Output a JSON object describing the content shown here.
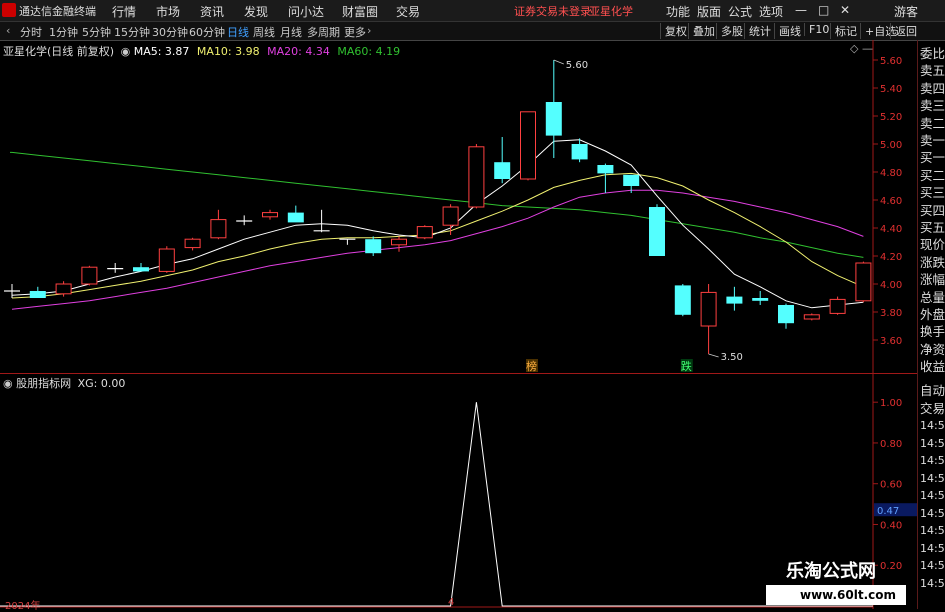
{
  "menu": {
    "app_title": "通达信金融终端",
    "items": [
      "行情",
      "市场",
      "资讯",
      "发现",
      "问小达",
      "财富圈",
      "交易"
    ],
    "status_text": "证券交易未登录",
    "stock_name": "亚星化学",
    "right_items": [
      "功能",
      "版面",
      "公式",
      "选项"
    ],
    "user": "游客"
  },
  "toolbar": {
    "periods": [
      "分时",
      "1分钟",
      "5分钟",
      "15分钟",
      "30分钟",
      "60分钟",
      "日线",
      "周线",
      "月线",
      "多周期",
      "更多"
    ],
    "active_period": "日线",
    "right_buttons": [
      "复权",
      "叠加",
      "多股",
      "统计",
      "画线",
      "F10",
      "标记",
      "+自选",
      "返回"
    ]
  },
  "main_legend": {
    "title": "亚星化学(日线 前复权)",
    "ma5": "MA5: 3.87",
    "ma10": "MA10: 3.98",
    "ma20": "MA20: 4.34",
    "ma60": "MA60: 4.19"
  },
  "indicator_legend": {
    "title": "股朋指标网",
    "xg": "XG: 0.00"
  },
  "annotations": {
    "high_label": "5.60",
    "low_label": "3.50",
    "bang_marker": "榜",
    "die_marker": "跌"
  },
  "axis": {
    "price_ticks": [
      "5.60",
      "5.40",
      "5.20",
      "5.00",
      "4.80",
      "4.60",
      "4.40",
      "4.20",
      "4.00",
      "3.80",
      "3.60"
    ],
    "indicator_ticks": [
      "1.00",
      "0.80",
      "0.60",
      "0.40",
      "0.20"
    ],
    "indicator_current": "0.47",
    "x_labels": [
      "2024年",
      "4"
    ]
  },
  "side_panel": {
    "top_items": [
      "委比",
      "卖五",
      "卖四",
      "卖三",
      "卖二",
      "卖一",
      "买一",
      "买二",
      "买三",
      "买四",
      "买五",
      "现价",
      "涨跌",
      "涨幅",
      "总量",
      "外盘",
      "换手",
      "净资",
      "收益"
    ],
    "bottom_items": [
      "自动",
      "交易",
      "14:55",
      "14:55",
      "14:55",
      "14:55",
      "14:56",
      "14:56",
      "14:56",
      "14:56",
      "14:56",
      "14:56"
    ]
  },
  "watermark": {
    "title": "乐淘公式网",
    "url": "www.60lt.com"
  },
  "colors": {
    "up": "#ff4040",
    "down": "#54ffff",
    "ma5": "#ffffff",
    "ma10": "#f0f070",
    "ma20": "#e040e0",
    "ma60": "#30c030",
    "axis": "#a01818",
    "indicator_line": "#ffffff"
  },
  "chart_data": [
    {
      "type": "candlestick",
      "ylim": [
        3.5,
        5.6
      ],
      "candles": [
        {
          "o": 3.95,
          "h": 4.0,
          "l": 3.9,
          "c": 3.95
        },
        {
          "o": 3.95,
          "h": 3.98,
          "l": 3.92,
          "c": 3.9
        },
        {
          "o": 3.93,
          "h": 4.02,
          "l": 3.91,
          "c": 4.0
        },
        {
          "o": 4.0,
          "h": 4.13,
          "l": 3.99,
          "c": 4.12
        },
        {
          "o": 4.11,
          "h": 4.15,
          "l": 4.08,
          "c": 4.11
        },
        {
          "o": 4.12,
          "h": 4.15,
          "l": 4.09,
          "c": 4.09
        },
        {
          "o": 4.09,
          "h": 4.27,
          "l": 4.08,
          "c": 4.25
        },
        {
          "o": 4.26,
          "h": 4.33,
          "l": 4.24,
          "c": 4.32
        },
        {
          "o": 4.33,
          "h": 4.53,
          "l": 4.32,
          "c": 4.46
        },
        {
          "o": 4.44,
          "h": 4.49,
          "l": 4.42,
          "c": 4.45
        },
        {
          "o": 4.48,
          "h": 4.53,
          "l": 4.46,
          "c": 4.51
        },
        {
          "o": 4.51,
          "h": 4.56,
          "l": 4.45,
          "c": 4.44
        },
        {
          "o": 4.38,
          "h": 4.53,
          "l": 4.37,
          "c": 4.38
        },
        {
          "o": 4.31,
          "h": 4.32,
          "l": 4.28,
          "c": 4.32
        },
        {
          "o": 4.32,
          "h": 4.34,
          "l": 4.2,
          "c": 4.22
        },
        {
          "o": 4.28,
          "h": 4.34,
          "l": 4.23,
          "c": 4.32
        },
        {
          "o": 4.33,
          "h": 4.42,
          "l": 4.32,
          "c": 4.41
        },
        {
          "o": 4.42,
          "h": 4.57,
          "l": 4.35,
          "c": 4.55
        },
        {
          "o": 4.55,
          "h": 5.0,
          "l": 4.54,
          "c": 4.98
        },
        {
          "o": 4.87,
          "h": 5.05,
          "l": 4.72,
          "c": 4.75
        },
        {
          "o": 4.75,
          "h": 5.23,
          "l": 4.74,
          "c": 5.23
        },
        {
          "o": 5.3,
          "h": 5.6,
          "l": 4.9,
          "c": 5.06
        },
        {
          "o": 5.0,
          "h": 5.04,
          "l": 4.87,
          "c": 4.89
        },
        {
          "o": 4.85,
          "h": 4.86,
          "l": 4.65,
          "c": 4.79
        },
        {
          "o": 4.78,
          "h": 4.78,
          "l": 4.65,
          "c": 4.7
        },
        {
          "o": 4.55,
          "h": 4.57,
          "l": 4.2,
          "c": 4.2
        },
        {
          "o": 3.99,
          "h": 4.0,
          "l": 3.77,
          "c": 3.78
        },
        {
          "o": 3.7,
          "h": 4.0,
          "l": 3.5,
          "c": 3.94
        },
        {
          "o": 3.91,
          "h": 3.98,
          "l": 3.81,
          "c": 3.86
        },
        {
          "o": 3.9,
          "h": 3.95,
          "l": 3.85,
          "c": 3.88
        },
        {
          "o": 3.85,
          "h": 3.86,
          "l": 3.68,
          "c": 3.72
        },
        {
          "o": 3.75,
          "h": 3.79,
          "l": 3.74,
          "c": 3.78
        },
        {
          "o": 3.79,
          "h": 3.91,
          "l": 3.78,
          "c": 3.89
        },
        {
          "o": 3.88,
          "h": 4.16,
          "l": 3.87,
          "c": 4.15
        }
      ],
      "ma5": [
        3.92,
        3.93,
        3.95,
        4.0,
        4.05,
        4.09,
        4.14,
        4.18,
        4.25,
        4.32,
        4.37,
        4.42,
        4.43,
        4.42,
        4.38,
        4.35,
        4.33,
        4.4,
        4.57,
        4.7,
        4.85,
        5.02,
        5.03,
        4.95,
        4.85,
        4.63,
        4.42,
        4.25,
        4.07,
        3.98,
        3.88,
        3.83,
        3.85,
        3.87
      ],
      "ma10": [
        3.9,
        3.91,
        3.93,
        3.96,
        3.99,
        4.02,
        4.06,
        4.1,
        4.16,
        4.2,
        4.25,
        4.29,
        4.32,
        4.33,
        4.33,
        4.34,
        4.35,
        4.38,
        4.45,
        4.52,
        4.6,
        4.69,
        4.74,
        4.78,
        4.79,
        4.76,
        4.7,
        4.6,
        4.51,
        4.41,
        4.3,
        4.16,
        4.06,
        3.98
      ],
      "ma20": [
        3.82,
        3.84,
        3.86,
        3.88,
        3.91,
        3.94,
        3.97,
        4.01,
        4.05,
        4.09,
        4.13,
        4.16,
        4.19,
        4.22,
        4.24,
        4.26,
        4.28,
        4.31,
        4.36,
        4.41,
        4.47,
        4.55,
        4.62,
        4.65,
        4.67,
        4.67,
        4.65,
        4.62,
        4.59,
        4.55,
        4.51,
        4.46,
        4.41,
        4.34
      ],
      "ma60": [
        4.94,
        4.92,
        4.9,
        4.88,
        4.86,
        4.84,
        4.82,
        4.8,
        4.78,
        4.76,
        4.74,
        4.72,
        4.7,
        4.68,
        4.66,
        4.64,
        4.62,
        4.6,
        4.58,
        4.56,
        4.55,
        4.54,
        4.53,
        4.51,
        4.49,
        4.46,
        4.43,
        4.4,
        4.37,
        4.33,
        4.3,
        4.26,
        4.22,
        4.19
      ]
    },
    {
      "type": "line",
      "title": "XG",
      "ylim": [
        0,
        1.05
      ],
      "values": [
        0,
        0,
        0,
        0,
        0,
        0,
        0,
        0,
        0,
        0,
        0,
        0,
        0,
        0,
        0,
        0,
        0,
        0,
        1,
        0,
        0,
        0,
        0,
        0,
        0,
        0,
        0,
        0,
        0,
        0,
        0,
        0,
        0,
        0
      ]
    }
  ]
}
